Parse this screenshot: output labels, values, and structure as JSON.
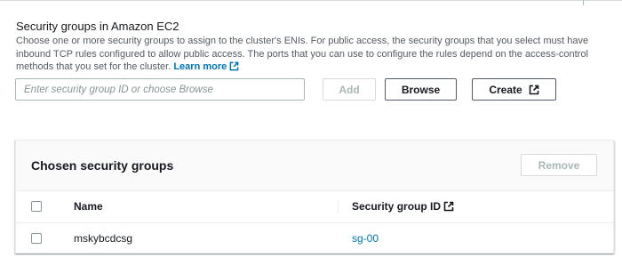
{
  "security_groups": {
    "title": "Security groups in Amazon EC2",
    "description": "Choose one or more security groups to assign to the cluster's ENIs. For public access, the security groups that you select must have inbound TCP rules configured to allow public access. The ports that you can use to configure the rules depend on the access-control methods that you set for the cluster.",
    "learn_more_label": "Learn more",
    "input": {
      "value": "",
      "placeholder": "Enter security group ID or choose Browse"
    },
    "add_label": "Add",
    "browse_label": "Browse",
    "create_label": "Create"
  },
  "chosen": {
    "title": "Chosen security groups",
    "remove_label": "Remove",
    "columns": {
      "name": "Name",
      "security_group_id": "Security group ID"
    },
    "rows": [
      {
        "name": "mskybcdcsg",
        "security_group_id": "sg-00",
        "selected": false
      }
    ]
  },
  "icons": {
    "external_link": "external-link-icon",
    "checkbox": "checkbox-icon"
  },
  "colors": {
    "link": "#0073bb",
    "text": "#16191f",
    "muted_text": "#545b64",
    "disabled": "#aab7b8",
    "border": "#eaeded"
  }
}
